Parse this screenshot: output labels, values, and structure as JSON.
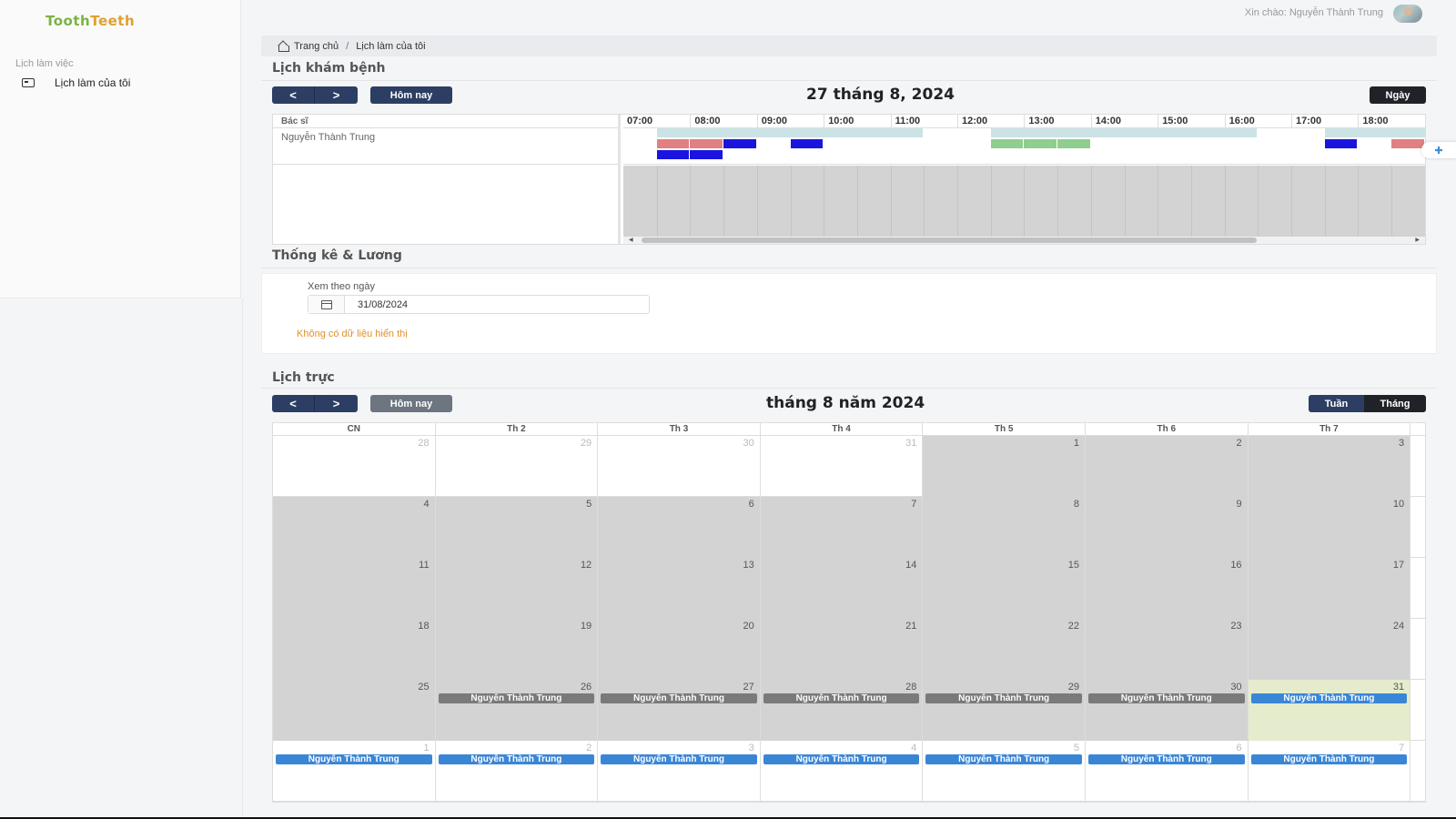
{
  "app": {
    "logo_part1": "Tooth",
    "logo_part2": "Teeth",
    "greeting": "Xin chào: Nguyễn Thành Trung"
  },
  "sidebar": {
    "section": "Lịch làm việc",
    "items": [
      {
        "label": "Lịch làm của tôi",
        "icon": "calendar-card-icon"
      }
    ]
  },
  "breadcrumb": {
    "home": "Trang chủ",
    "separator": "/",
    "current": "Lịch làm của tôi"
  },
  "exam_schedule": {
    "title": "Lịch khám bệnh",
    "prev": "<",
    "next": ">",
    "today": "Hôm nay",
    "date_title": "27 tháng 8, 2024",
    "view_day": "Ngày",
    "resource_header": "Bác sĩ",
    "resource_name": "Nguyễn Thành Trung",
    "hours": [
      "07:00",
      "08:00",
      "09:00",
      "10:00",
      "11:00",
      "12:00",
      "13:00",
      "14:00",
      "15:00",
      "16:00",
      "17:00",
      "18:00"
    ],
    "events": [
      {
        "start": 7.5,
        "end": 11.5,
        "lane": 0,
        "color": "#cce3e6"
      },
      {
        "start": 12.5,
        "end": 16.5,
        "lane": 0,
        "color": "#cce3e6"
      },
      {
        "start": 17.5,
        "end": 19.5,
        "lane": 0,
        "color": "#cce3e6"
      },
      {
        "start": 7.5,
        "end": 8.0,
        "lane": 1,
        "color": "#e08080"
      },
      {
        "start": 8.0,
        "end": 8.5,
        "lane": 1,
        "color": "#e08080"
      },
      {
        "start": 8.5,
        "end": 9.0,
        "lane": 1,
        "color": "#1a14e0"
      },
      {
        "start": 9.5,
        "end": 10.0,
        "lane": 1,
        "color": "#1a14e0"
      },
      {
        "start": 12.5,
        "end": 13.0,
        "lane": 1,
        "color": "#8fce8f"
      },
      {
        "start": 13.0,
        "end": 13.5,
        "lane": 1,
        "color": "#8fce8f"
      },
      {
        "start": 13.5,
        "end": 14.0,
        "lane": 1,
        "color": "#8fce8f"
      },
      {
        "start": 17.5,
        "end": 18.0,
        "lane": 1,
        "color": "#1a14e0"
      },
      {
        "start": 18.5,
        "end": 19.0,
        "lane": 1,
        "color": "#e08080"
      },
      {
        "start": 7.5,
        "end": 8.0,
        "lane": 2,
        "color": "#1a14e0"
      },
      {
        "start": 8.0,
        "end": 8.5,
        "lane": 2,
        "color": "#1a14e0"
      }
    ]
  },
  "stats": {
    "title": "Thống kê & Lương",
    "view_by_label": "Xem theo ngày",
    "date_value": "31/08/2024",
    "no_data": "Không có dữ liệu hiển thị"
  },
  "duty": {
    "title": "Lịch trực",
    "prev": "<",
    "next": ">",
    "today": "Hôm nay",
    "month_title": "tháng 8 năm 2024",
    "view_week": "Tuần",
    "view_month": "Tháng",
    "weekdays": [
      "CN",
      "Th 2",
      "Th 3",
      "Th 4",
      "Th 5",
      "Th 6",
      "Th 7"
    ],
    "weeks": [
      [
        {
          "d": "28",
          "other": true,
          "gray": false
        },
        {
          "d": "29",
          "other": true,
          "gray": false
        },
        {
          "d": "30",
          "other": true,
          "gray": false
        },
        {
          "d": "31",
          "other": true,
          "gray": false
        },
        {
          "d": "1",
          "gray": true
        },
        {
          "d": "2",
          "gray": true
        },
        {
          "d": "3",
          "gray": true
        }
      ],
      [
        {
          "d": "4",
          "gray": true
        },
        {
          "d": "5",
          "gray": true
        },
        {
          "d": "6",
          "gray": true
        },
        {
          "d": "7",
          "gray": true
        },
        {
          "d": "8",
          "gray": true
        },
        {
          "d": "9",
          "gray": true
        },
        {
          "d": "10",
          "gray": true
        }
      ],
      [
        {
          "d": "11",
          "gray": true
        },
        {
          "d": "12",
          "gray": true
        },
        {
          "d": "13",
          "gray": true
        },
        {
          "d": "14",
          "gray": true
        },
        {
          "d": "15",
          "gray": true
        },
        {
          "d": "16",
          "gray": true
        },
        {
          "d": "17",
          "gray": true
        }
      ],
      [
        {
          "d": "18",
          "gray": true
        },
        {
          "d": "19",
          "gray": true
        },
        {
          "d": "20",
          "gray": true
        },
        {
          "d": "21",
          "gray": true
        },
        {
          "d": "22",
          "gray": true
        },
        {
          "d": "23",
          "gray": true
        },
        {
          "d": "24",
          "gray": true
        }
      ],
      [
        {
          "d": "25",
          "gray": true
        },
        {
          "d": "26",
          "gray": true,
          "ev": "Nguyễn Thành Trung",
          "evType": "gray"
        },
        {
          "d": "27",
          "gray": true,
          "ev": "Nguyễn Thành Trung",
          "evType": "gray"
        },
        {
          "d": "28",
          "gray": true,
          "ev": "Nguyễn Thành Trung",
          "evType": "gray"
        },
        {
          "d": "29",
          "gray": true,
          "ev": "Nguyễn Thành Trung",
          "evType": "gray"
        },
        {
          "d": "30",
          "gray": true,
          "ev": "Nguyễn Thành Trung",
          "evType": "gray"
        },
        {
          "d": "31",
          "today": true,
          "ev": "Nguyễn Thành Trung",
          "evType": "blue"
        }
      ],
      [
        {
          "d": "1",
          "other": true,
          "ev": "Nguyễn Thành Trung",
          "evType": "blue"
        },
        {
          "d": "2",
          "other": true,
          "ev": "Nguyễn Thành Trung",
          "evType": "blue"
        },
        {
          "d": "3",
          "other": true,
          "ev": "Nguyễn Thành Trung",
          "evType": "blue"
        },
        {
          "d": "4",
          "other": true,
          "ev": "Nguyễn Thành Trung",
          "evType": "blue"
        },
        {
          "d": "5",
          "other": true,
          "ev": "Nguyễn Thành Trung",
          "evType": "blue"
        },
        {
          "d": "6",
          "other": true,
          "ev": "Nguyễn Thành Trung",
          "evType": "blue"
        },
        {
          "d": "7",
          "other": true,
          "ev": "Nguyễn Thành Trung",
          "evType": "blue"
        }
      ]
    ]
  }
}
